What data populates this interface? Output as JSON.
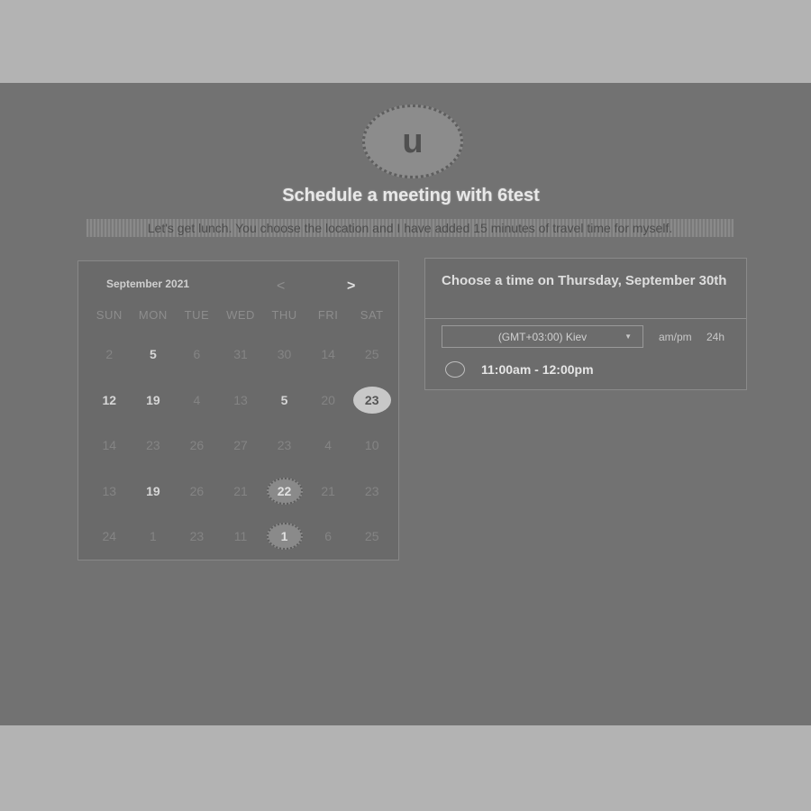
{
  "host": {
    "avatar_letter": "u",
    "title": "Schedule a meeting with 6test",
    "description": "Let's get lunch. You choose the location and I have added 15 minutes of travel time for myself."
  },
  "calendar": {
    "month_label": "September 2021",
    "prev_icon": "chevron-left-icon",
    "next_icon": "chevron-right-icon",
    "prev_label": "<",
    "next_label": ">",
    "weekdays": [
      "SUN",
      "MON",
      "TUE",
      "WED",
      "THU",
      "FRI",
      "SAT"
    ],
    "weeks": [
      [
        {
          "d": "2",
          "s": "off"
        },
        {
          "d": "5",
          "s": "avail"
        },
        {
          "d": "6",
          "s": "off"
        },
        {
          "d": "31",
          "s": "off"
        },
        {
          "d": "30",
          "s": "off"
        },
        {
          "d": "14",
          "s": "off"
        },
        {
          "d": "25",
          "s": "off"
        }
      ],
      [
        {
          "d": "12",
          "s": "avail"
        },
        {
          "d": "19",
          "s": "avail"
        },
        {
          "d": "4",
          "s": "off"
        },
        {
          "d": "13",
          "s": "off"
        },
        {
          "d": "5",
          "s": "avail"
        },
        {
          "d": "20",
          "s": "off"
        },
        {
          "d": "23",
          "s": "selected"
        }
      ],
      [
        {
          "d": "14",
          "s": "off"
        },
        {
          "d": "23",
          "s": "off"
        },
        {
          "d": "26",
          "s": "off"
        },
        {
          "d": "27",
          "s": "off"
        },
        {
          "d": "23",
          "s": "off"
        },
        {
          "d": "4",
          "s": "off"
        },
        {
          "d": "10",
          "s": "off"
        }
      ],
      [
        {
          "d": "13",
          "s": "off"
        },
        {
          "d": "19",
          "s": "avail"
        },
        {
          "d": "26",
          "s": "off"
        },
        {
          "d": "21",
          "s": "off"
        },
        {
          "d": "22",
          "s": "marked"
        },
        {
          "d": "21",
          "s": "off"
        },
        {
          "d": "23",
          "s": "off"
        }
      ],
      [
        {
          "d": "24",
          "s": "off"
        },
        {
          "d": "1",
          "s": "off"
        },
        {
          "d": "23",
          "s": "off"
        },
        {
          "d": "11",
          "s": "off"
        },
        {
          "d": "1",
          "s": "marked"
        },
        {
          "d": "6",
          "s": "off"
        },
        {
          "d": "25",
          "s": "off"
        }
      ]
    ]
  },
  "time_panel": {
    "heading": "Choose a time on Thursday, September 30th",
    "timezone": "(GMT+03:00) Kiev",
    "format_ampm": "am/pm",
    "format_24h": "24h",
    "slots": [
      "11:00am - 12:00pm"
    ]
  }
}
